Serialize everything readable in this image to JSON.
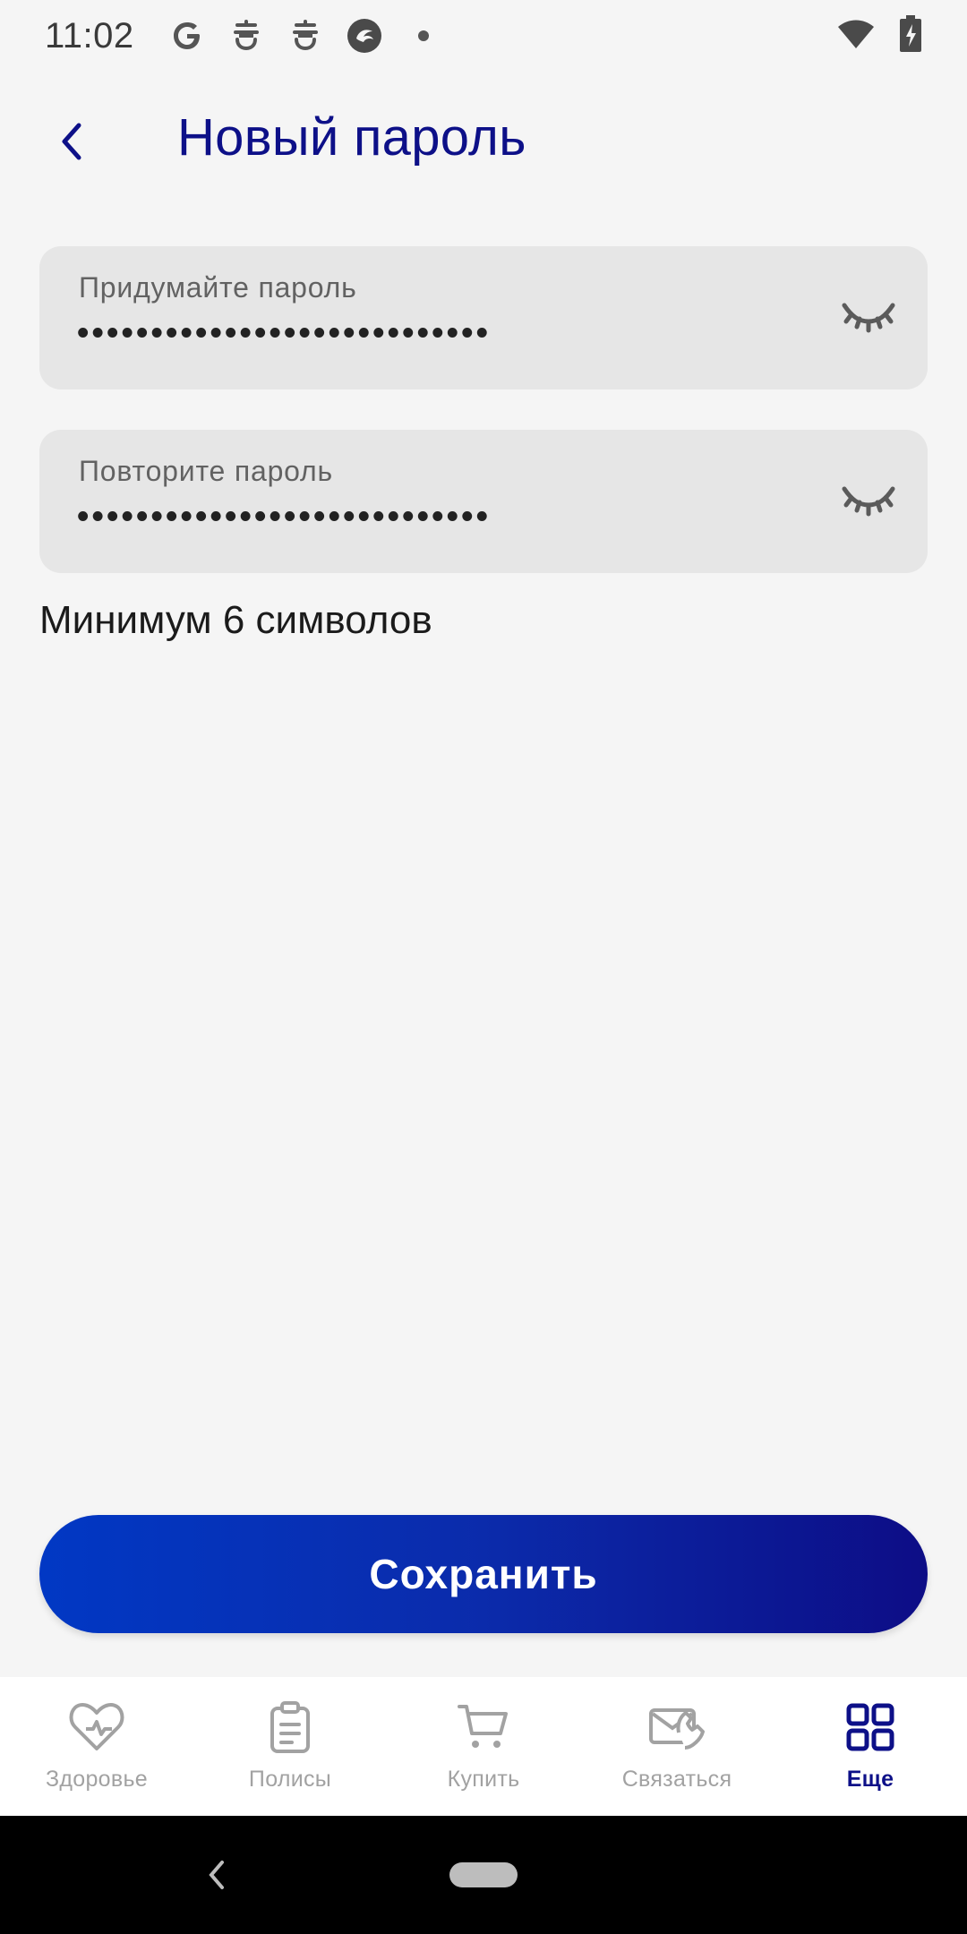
{
  "status_bar": {
    "time": "11:02",
    "left_icons": [
      "google-icon",
      "app-notification-icon",
      "app-notification-icon",
      "browser-icon",
      "dot-icon"
    ],
    "right_icons": [
      "wifi-icon",
      "battery-charging-icon"
    ]
  },
  "header": {
    "back_icon": "chevron-left-icon",
    "title": "Новый пароль"
  },
  "form": {
    "password": {
      "label": "Придумайте пароль",
      "value": "••••••••••••••••••••••••••••",
      "toggle_icon": "eye-closed-icon"
    },
    "confirm": {
      "label": "Повторите пароль",
      "value": "••••••••••••••••••••••••••••",
      "toggle_icon": "eye-closed-icon"
    },
    "hint": "Минимум 6 символов"
  },
  "save_button": {
    "label": "Сохранить",
    "colors": [
      "#0138c4",
      "#0d0d86"
    ]
  },
  "bottom_nav": {
    "items": [
      {
        "label": "Здоровье",
        "icon": "heart-pulse-icon",
        "active": false
      },
      {
        "label": "Полисы",
        "icon": "clipboard-icon",
        "active": false
      },
      {
        "label": "Купить",
        "icon": "cart-icon",
        "active": false
      },
      {
        "label": "Связаться",
        "icon": "envelope-phone-icon",
        "active": false
      },
      {
        "label": "Еще",
        "icon": "grid-icon",
        "active": true
      }
    ]
  },
  "colors": {
    "accent": "#0d1088",
    "background": "#f5f5f5",
    "field_bg": "#e6e6e6",
    "inactive": "#a2a2a2"
  }
}
